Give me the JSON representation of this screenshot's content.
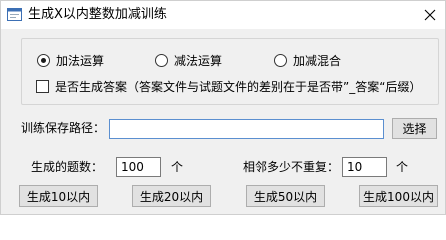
{
  "window": {
    "title": "生成X以内整数加减训练",
    "icon": "app-form-icon",
    "close_icon": "close-icon"
  },
  "operation": {
    "options": [
      {
        "label": "加法运算",
        "checked": true
      },
      {
        "label": "减法运算",
        "checked": false
      },
      {
        "label": "加减混合",
        "checked": false
      }
    ]
  },
  "answer_option": {
    "label": "是否生成答案（答案文件与试题文件的差别在于是否带”_答案“后缀）",
    "checked": false
  },
  "save_path": {
    "label": "训练保存路径：",
    "value": "",
    "browse_label": "选择"
  },
  "count": {
    "label": "生成的题数：",
    "value": "100",
    "unit": "个"
  },
  "no_repeat": {
    "label": "相邻多少不重复：",
    "value": "10",
    "unit": "个"
  },
  "generate_buttons": [
    "生成10以内",
    "生成20以内",
    "生成50以内",
    "生成100以内"
  ]
}
